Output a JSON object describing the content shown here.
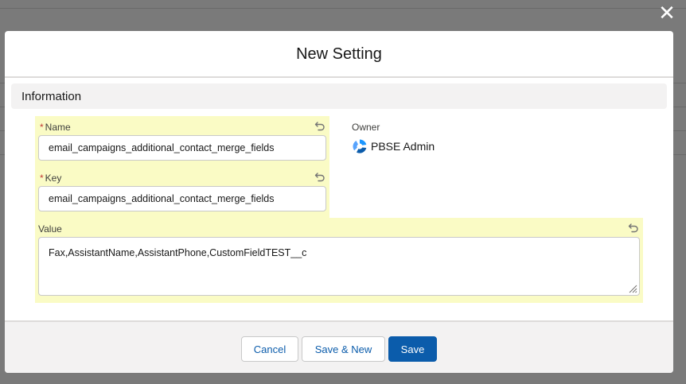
{
  "close_icon": "close-icon",
  "modal": {
    "title": "New Setting"
  },
  "section": {
    "title": "Information"
  },
  "fields": {
    "name": {
      "required_mark": "*",
      "label": "Name",
      "value": "email_campaigns_additional_contact_merge_fields"
    },
    "key": {
      "required_mark": "*",
      "label": "Key",
      "value": "email_campaigns_additional_contact_merge_fields"
    },
    "value": {
      "label": "Value",
      "value": "Fax,AssistantName,AssistantPhone,CustomFieldTEST__c"
    }
  },
  "owner": {
    "label": "Owner",
    "name": "PBSE Admin",
    "icon": "user-avatar-icon"
  },
  "footer": {
    "cancel_label": "Cancel",
    "save_new_label": "Save & New",
    "save_label": "Save"
  },
  "colors": {
    "brand": "#0b5cab",
    "edited_highlight": "#fafbc5",
    "required": "#c23934"
  }
}
